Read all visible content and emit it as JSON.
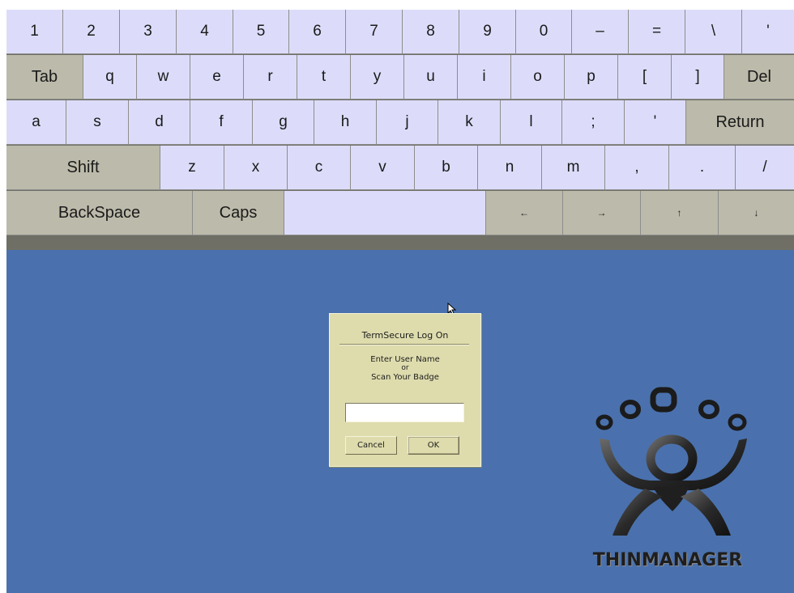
{
  "keyboard": {
    "row1": [
      "1",
      "2",
      "3",
      "4",
      "5",
      "6",
      "7",
      "8",
      "9",
      "0",
      "–",
      "=",
      "\\",
      "'"
    ],
    "row2": [
      "Tab",
      "q",
      "w",
      "e",
      "r",
      "t",
      "y",
      "u",
      "i",
      "o",
      "p",
      "[",
      "]",
      "Del"
    ],
    "row3": [
      "a",
      "s",
      "d",
      "f",
      "g",
      "h",
      "j",
      "k",
      "l",
      ";",
      "'",
      "Return"
    ],
    "row4": [
      "Shift",
      "z",
      "x",
      "c",
      "v",
      "b",
      "n",
      "m",
      ",",
      ".",
      "/"
    ],
    "row5": [
      "BackSpace",
      "Caps",
      "",
      "←",
      "→",
      "↑",
      "↓"
    ]
  },
  "logon": {
    "title": "TermSecure Log On",
    "prompt_line1": "Enter User Name",
    "prompt_line2": "or",
    "prompt_line3": "Scan Your Badge",
    "username_value": "",
    "cancel_label": "Cancel",
    "ok_label": "OK"
  },
  "brand": {
    "name": "THINMANAGER"
  },
  "colors": {
    "desktop": "#4a71ad",
    "key": "#dcdcfa",
    "modifier_key": "#bcbaaa",
    "dialog": "#dedcad"
  }
}
